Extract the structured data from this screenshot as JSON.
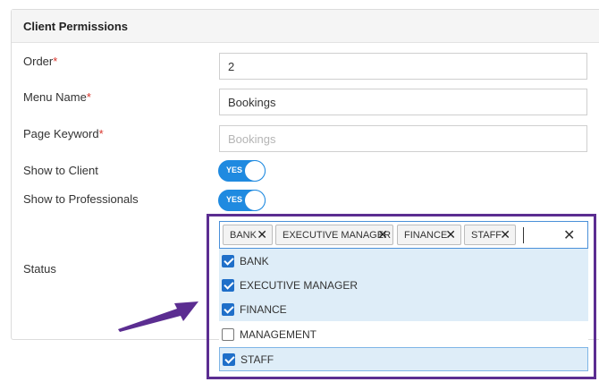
{
  "card": {
    "title": "Client Permissions"
  },
  "form": {
    "order": {
      "label": "Order",
      "required": "*",
      "value": "2"
    },
    "menu_name": {
      "label": "Menu Name",
      "required": "*",
      "value": "Bookings"
    },
    "page_keyword": {
      "label": "Page Keyword",
      "required": "*",
      "placeholder": "Bookings"
    },
    "show_to_client": {
      "label": "Show to Client",
      "toggle": "YES"
    },
    "show_to_professionals": {
      "label": "Show to Professionals",
      "toggle": "YES"
    },
    "status": {
      "label": "Status",
      "chips": [
        "BANK",
        "EXECUTIVE MANAGER",
        "FINANCE",
        "STAFF"
      ],
      "chip_remove": "✕",
      "clear_all": "✕",
      "options": [
        {
          "label": "BANK",
          "checked": true
        },
        {
          "label": "EXECUTIVE MANAGER",
          "checked": true
        },
        {
          "label": "FINANCE",
          "checked": true
        },
        {
          "label": "MANAGEMENT",
          "checked": false
        },
        {
          "label": "STAFF",
          "checked": true
        }
      ]
    }
  },
  "colors": {
    "toggle_on": "#1f8ae0",
    "required": "#d9342b",
    "highlight": "#5b2d91",
    "checkbox": "#1f6fc9",
    "selected_row": "#deedf8"
  }
}
